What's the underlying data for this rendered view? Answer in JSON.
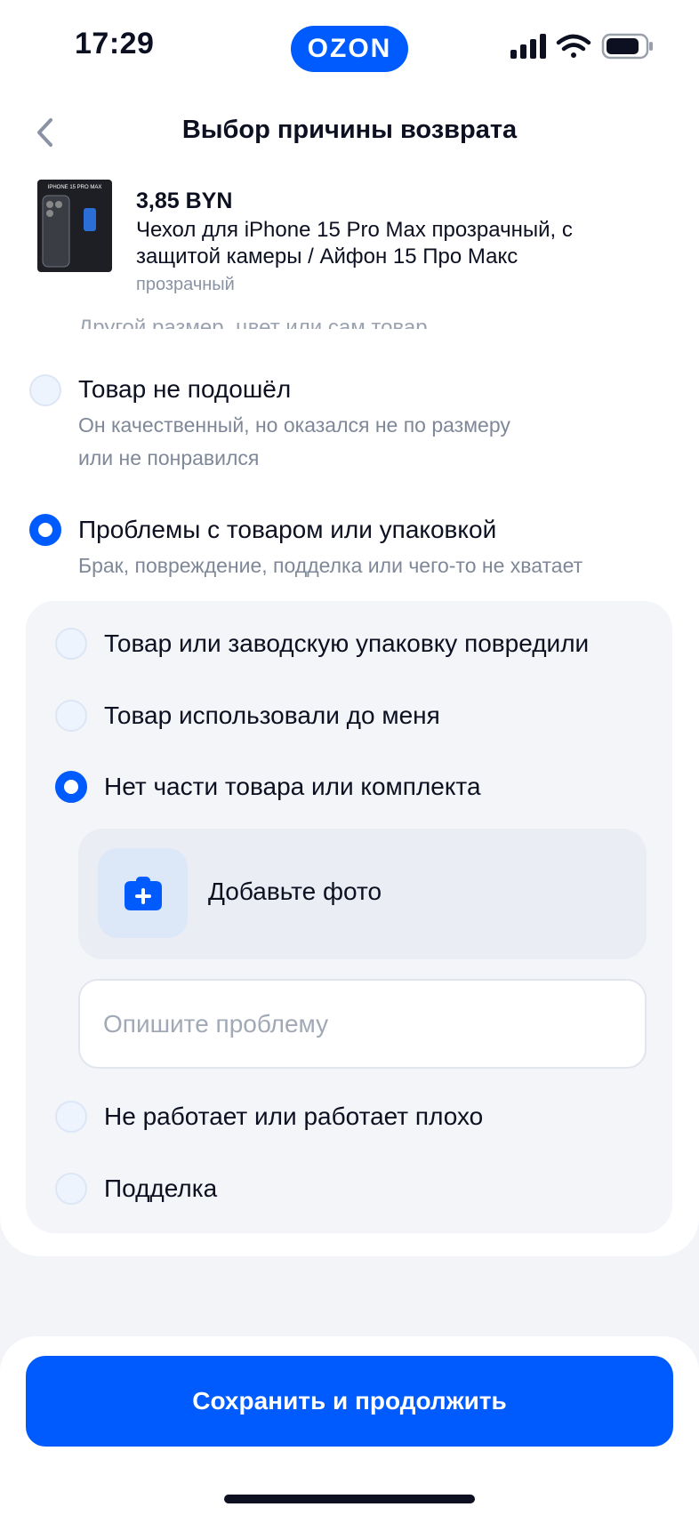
{
  "status_bar": {
    "time": "17:29",
    "brand": "OZON"
  },
  "header": {
    "back_icon": "chevron-left-icon",
    "title": "Выбор причины возврата"
  },
  "product": {
    "price": "3,85 BYN",
    "name": "Чехол для iPhone 15 Pro Max прозрачный, с защитой камеры / Айфон 15 Про Макс",
    "variant": "прозрачный",
    "thumb_label": "IPHONE 15 PRO MAX"
  },
  "options": {
    "cut_off_text": "Другой размер, цвет или сам товар",
    "not_fit": {
      "title": "Товар не подошёл",
      "subtitle_line1": "Он качественный, но оказался не по размеру",
      "subtitle_line2": "или не понравился",
      "selected": false
    },
    "problems": {
      "title": "Проблемы с товаром или упаковкой",
      "subtitle": "Брак, повреждение, подделка или чего-то не хватает",
      "selected": true
    }
  },
  "sub_options": [
    {
      "label": "Товар или заводскую упаковку повредили",
      "selected": false
    },
    {
      "label": "Товар использовали до меня",
      "selected": false
    },
    {
      "label": "Нет части товара или комплекта",
      "selected": true
    },
    {
      "label": "Не работает или работает плохо",
      "selected": false
    },
    {
      "label": "Подделка",
      "selected": false
    }
  ],
  "photo": {
    "label": "Добавьте фото",
    "icon": "camera-plus-icon"
  },
  "describe": {
    "placeholder": "Опишите проблему",
    "value": ""
  },
  "footer": {
    "save_label": "Сохранить и продолжить"
  },
  "colors": {
    "accent": "#005bff",
    "background": "#f2f4f8",
    "panel": "#f3f5f9",
    "muted_text": "#7f8898"
  }
}
